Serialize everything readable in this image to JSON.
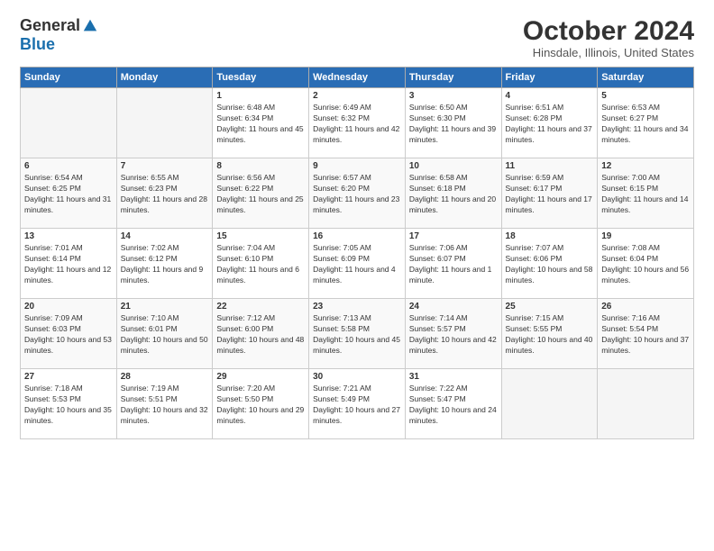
{
  "header": {
    "logo": {
      "general": "General",
      "blue": "Blue"
    },
    "title": "October 2024",
    "location": "Hinsdale, Illinois, United States"
  },
  "calendar": {
    "days_header": [
      "Sunday",
      "Monday",
      "Tuesday",
      "Wednesday",
      "Thursday",
      "Friday",
      "Saturday"
    ],
    "weeks": [
      [
        {
          "day": "",
          "empty": true
        },
        {
          "day": "",
          "empty": true
        },
        {
          "day": "1",
          "sunrise": "6:48 AM",
          "sunset": "6:34 PM",
          "daylight": "11 hours and 45 minutes."
        },
        {
          "day": "2",
          "sunrise": "6:49 AM",
          "sunset": "6:32 PM",
          "daylight": "11 hours and 42 minutes."
        },
        {
          "day": "3",
          "sunrise": "6:50 AM",
          "sunset": "6:30 PM",
          "daylight": "11 hours and 39 minutes."
        },
        {
          "day": "4",
          "sunrise": "6:51 AM",
          "sunset": "6:28 PM",
          "daylight": "11 hours and 37 minutes."
        },
        {
          "day": "5",
          "sunrise": "6:53 AM",
          "sunset": "6:27 PM",
          "daylight": "11 hours and 34 minutes."
        }
      ],
      [
        {
          "day": "6",
          "sunrise": "6:54 AM",
          "sunset": "6:25 PM",
          "daylight": "11 hours and 31 minutes."
        },
        {
          "day": "7",
          "sunrise": "6:55 AM",
          "sunset": "6:23 PM",
          "daylight": "11 hours and 28 minutes."
        },
        {
          "day": "8",
          "sunrise": "6:56 AM",
          "sunset": "6:22 PM",
          "daylight": "11 hours and 25 minutes."
        },
        {
          "day": "9",
          "sunrise": "6:57 AM",
          "sunset": "6:20 PM",
          "daylight": "11 hours and 23 minutes."
        },
        {
          "day": "10",
          "sunrise": "6:58 AM",
          "sunset": "6:18 PM",
          "daylight": "11 hours and 20 minutes."
        },
        {
          "day": "11",
          "sunrise": "6:59 AM",
          "sunset": "6:17 PM",
          "daylight": "11 hours and 17 minutes."
        },
        {
          "day": "12",
          "sunrise": "7:00 AM",
          "sunset": "6:15 PM",
          "daylight": "11 hours and 14 minutes."
        }
      ],
      [
        {
          "day": "13",
          "sunrise": "7:01 AM",
          "sunset": "6:14 PM",
          "daylight": "11 hours and 12 minutes."
        },
        {
          "day": "14",
          "sunrise": "7:02 AM",
          "sunset": "6:12 PM",
          "daylight": "11 hours and 9 minutes."
        },
        {
          "day": "15",
          "sunrise": "7:04 AM",
          "sunset": "6:10 PM",
          "daylight": "11 hours and 6 minutes."
        },
        {
          "day": "16",
          "sunrise": "7:05 AM",
          "sunset": "6:09 PM",
          "daylight": "11 hours and 4 minutes."
        },
        {
          "day": "17",
          "sunrise": "7:06 AM",
          "sunset": "6:07 PM",
          "daylight": "11 hours and 1 minute."
        },
        {
          "day": "18",
          "sunrise": "7:07 AM",
          "sunset": "6:06 PM",
          "daylight": "10 hours and 58 minutes."
        },
        {
          "day": "19",
          "sunrise": "7:08 AM",
          "sunset": "6:04 PM",
          "daylight": "10 hours and 56 minutes."
        }
      ],
      [
        {
          "day": "20",
          "sunrise": "7:09 AM",
          "sunset": "6:03 PM",
          "daylight": "10 hours and 53 minutes."
        },
        {
          "day": "21",
          "sunrise": "7:10 AM",
          "sunset": "6:01 PM",
          "daylight": "10 hours and 50 minutes."
        },
        {
          "day": "22",
          "sunrise": "7:12 AM",
          "sunset": "6:00 PM",
          "daylight": "10 hours and 48 minutes."
        },
        {
          "day": "23",
          "sunrise": "7:13 AM",
          "sunset": "5:58 PM",
          "daylight": "10 hours and 45 minutes."
        },
        {
          "day": "24",
          "sunrise": "7:14 AM",
          "sunset": "5:57 PM",
          "daylight": "10 hours and 42 minutes."
        },
        {
          "day": "25",
          "sunrise": "7:15 AM",
          "sunset": "5:55 PM",
          "daylight": "10 hours and 40 minutes."
        },
        {
          "day": "26",
          "sunrise": "7:16 AM",
          "sunset": "5:54 PM",
          "daylight": "10 hours and 37 minutes."
        }
      ],
      [
        {
          "day": "27",
          "sunrise": "7:18 AM",
          "sunset": "5:53 PM",
          "daylight": "10 hours and 35 minutes."
        },
        {
          "day": "28",
          "sunrise": "7:19 AM",
          "sunset": "5:51 PM",
          "daylight": "10 hours and 32 minutes."
        },
        {
          "day": "29",
          "sunrise": "7:20 AM",
          "sunset": "5:50 PM",
          "daylight": "10 hours and 29 minutes."
        },
        {
          "day": "30",
          "sunrise": "7:21 AM",
          "sunset": "5:49 PM",
          "daylight": "10 hours and 27 minutes."
        },
        {
          "day": "31",
          "sunrise": "7:22 AM",
          "sunset": "5:47 PM",
          "daylight": "10 hours and 24 minutes."
        },
        {
          "day": "",
          "empty": true
        },
        {
          "day": "",
          "empty": true
        }
      ]
    ]
  }
}
